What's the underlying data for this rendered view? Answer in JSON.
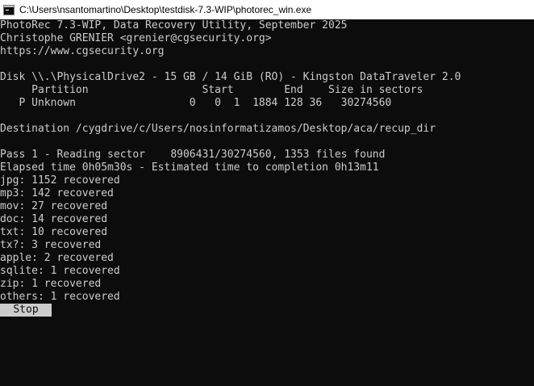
{
  "window": {
    "title": "C:\\Users\\nsantomartino\\Desktop\\testdisk-7.3-WIP\\photorec_win.exe",
    "icon": "cmd-icon"
  },
  "console": {
    "header": [
      "PhotoRec 7.3-WIP, Data Recovery Utility, September 2025",
      "Christophe GRENIER <grenier@cgsecurity.org>",
      "https://www.cgsecurity.org"
    ],
    "disk": "Disk \\\\.\\PhysicalDrive2 - 15 GB / 14 GiB (RO) - Kingston DataTraveler 2.0",
    "partition_header": "     Partition                  Start        End    Size in sectors",
    "partition_row": "   P Unknown                  0   0  1  1884 128 36   30274560",
    "destination": "Destination /cygdrive/c/Users/nosinformatizamos/Desktop/aca/recup_dir",
    "pass": "Pass 1 - Reading sector    8906431/30274560, 1353 files found",
    "elapsed": "Elapsed time 0h05m30s - Estimated time to completion 0h13m11",
    "recovered": [
      "jpg: 1152 recovered",
      "mp3: 142 recovered",
      "mov: 27 recovered",
      "doc: 14 recovered",
      "txt: 10 recovered",
      "tx?: 3 recovered",
      "apple: 2 recovered",
      "sqlite: 1 recovered",
      "zip: 1 recovered",
      "others: 1 recovered"
    ],
    "stop_label": "Stop"
  },
  "colors": {
    "background": "#0c0c0c",
    "text": "#cccccc",
    "button_bg": "#cccccc",
    "button_text": "#0c0c0c"
  }
}
